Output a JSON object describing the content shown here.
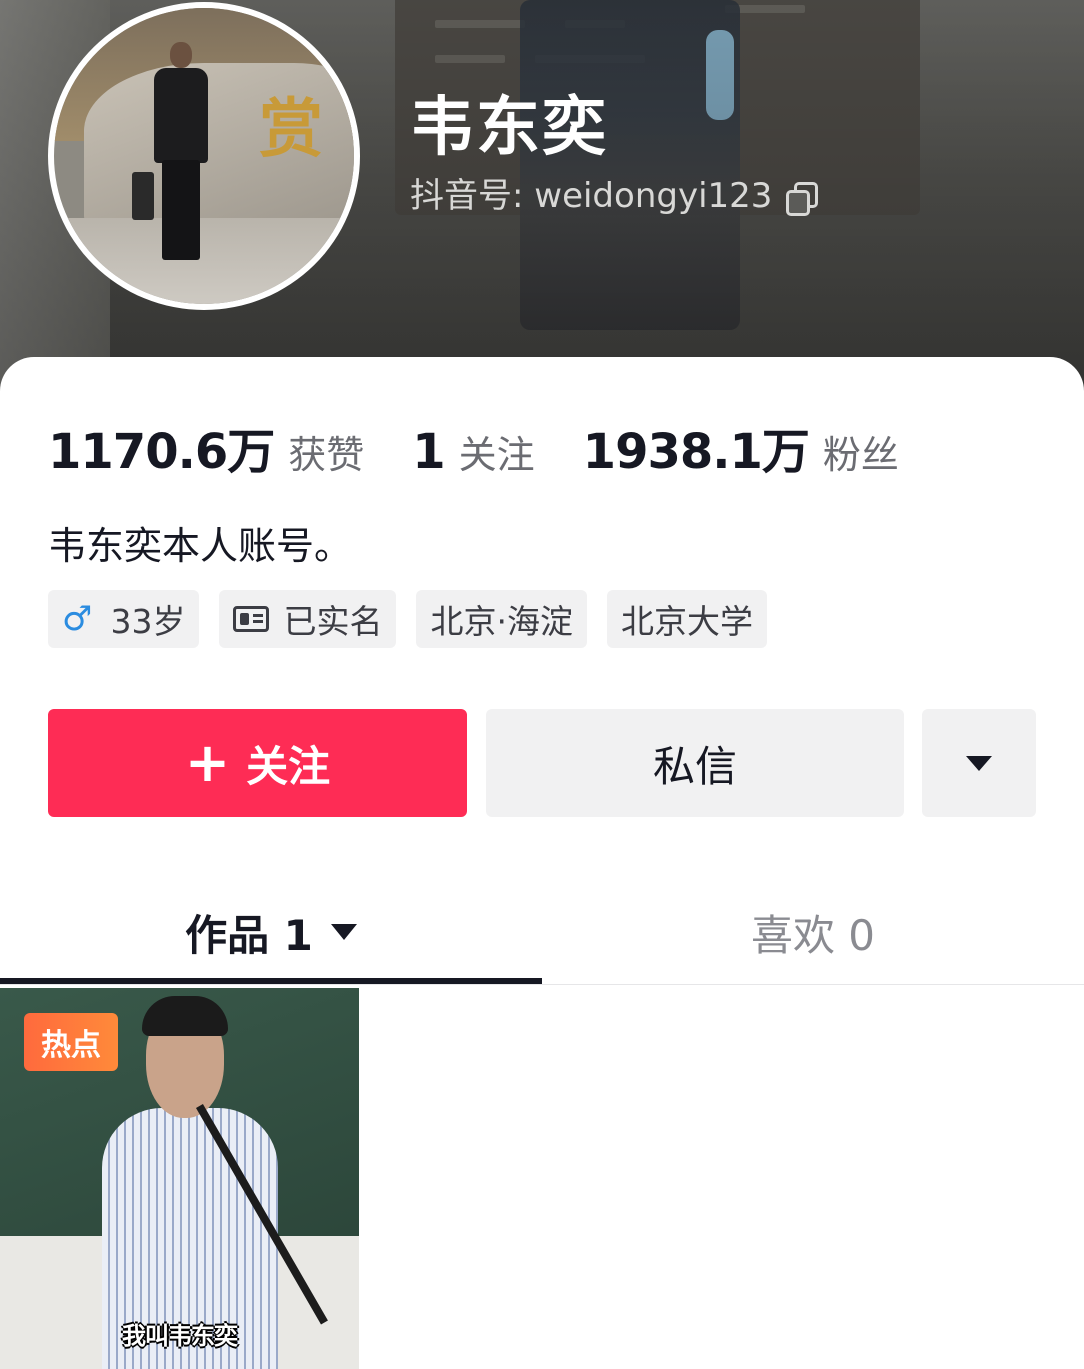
{
  "profile": {
    "name": "韦东奕",
    "douyin_id": "抖音号: weidongyi123",
    "bio": "韦东奕本人账号。"
  },
  "stats": [
    {
      "value": "1170.6万",
      "label": "获赞"
    },
    {
      "value": "1",
      "label": "关注"
    },
    {
      "value": "1938.1万",
      "label": "粉丝"
    }
  ],
  "tags": {
    "gender_age": "33岁",
    "gender_symbol": "♂",
    "verified": "已实名",
    "location": "北京·海淀",
    "school": "北京大学"
  },
  "actions": {
    "follow_label": "关注",
    "follow_icon": "+",
    "message_label": "私信",
    "more_icon": "caret-down-icon"
  },
  "tabs": {
    "works": "作品 1",
    "likes": "喜欢 0"
  },
  "videos": [
    {
      "badge": "热点",
      "caption": "我叫韦东奕"
    }
  ],
  "colors": {
    "accent": "#fe2c55",
    "tag_bg": "#f1f1f2",
    "text": "#161823",
    "muted": "#6b6c72",
    "hot_badge": "#ff6a3d"
  }
}
